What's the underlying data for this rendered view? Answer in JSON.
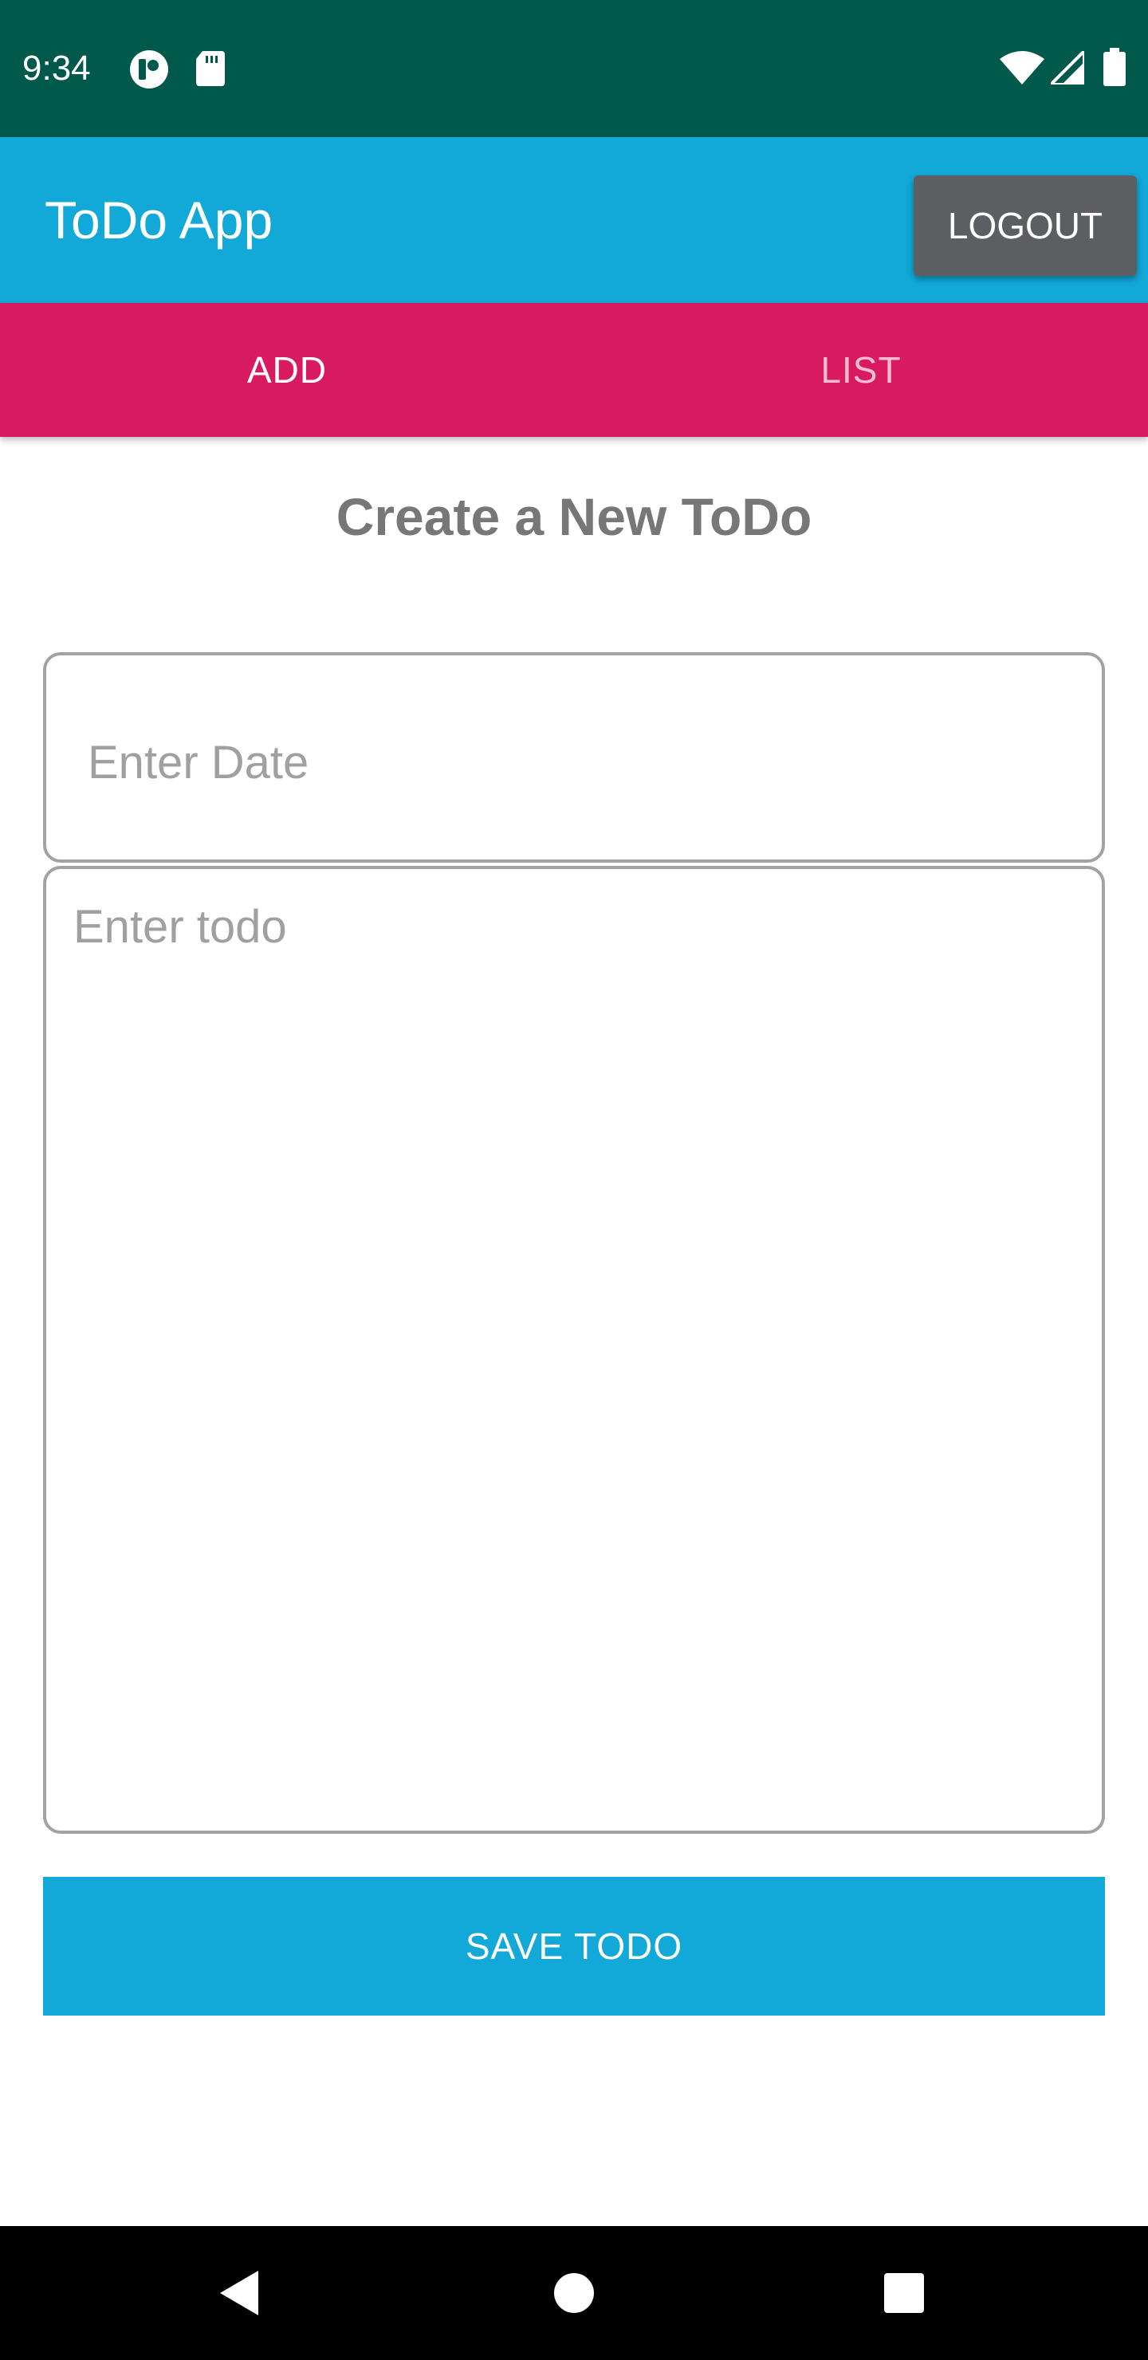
{
  "status_bar": {
    "time": "9:34",
    "left_icons": [
      "app-notification-icon",
      "sd-card-icon"
    ],
    "right_icons": [
      "wifi-icon",
      "signal-icon",
      "battery-icon"
    ]
  },
  "app_bar": {
    "title": "ToDo App",
    "logout_label": "LOGOUT"
  },
  "tabs": [
    {
      "label": "ADD",
      "selected": true
    },
    {
      "label": "LIST",
      "selected": false
    }
  ],
  "form": {
    "title": "Create a New ToDo",
    "date_placeholder": "Enter Date",
    "date_value": "",
    "todo_placeholder": "Enter todo",
    "todo_value": "",
    "save_label": "SAVE TODO"
  },
  "nav_bar": {
    "buttons": [
      "back-icon",
      "home-icon",
      "recents-icon"
    ]
  },
  "colors": {
    "status_bar": "#00594b",
    "app_bar": "#12a8d7",
    "tab_bar": "#d81b60",
    "logout_button": "#5d5e61",
    "save_button": "#12a8d7"
  }
}
